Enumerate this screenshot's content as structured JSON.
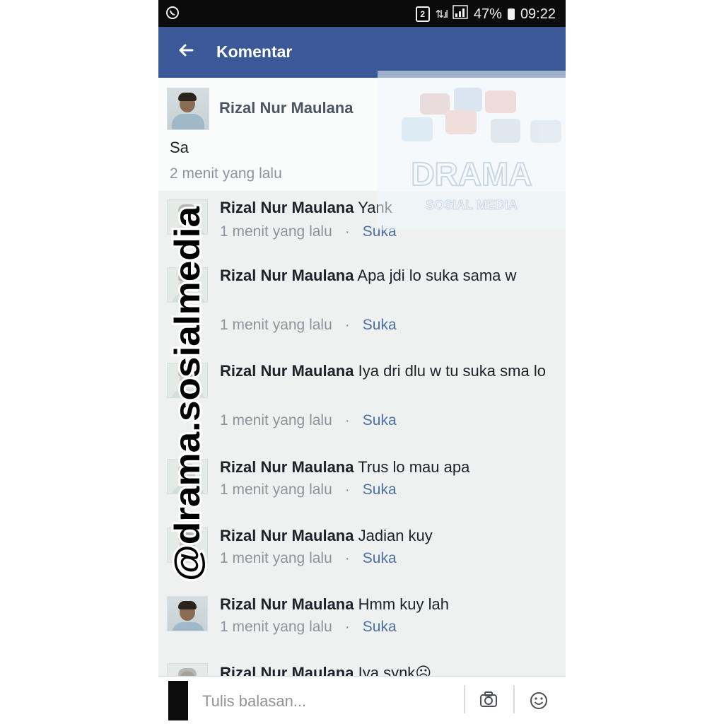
{
  "status_bar": {
    "left_icon": "whatsapp-icon",
    "sim": "2",
    "battery": "47%",
    "time": "09:22"
  },
  "header": {
    "back_icon": "arrow-left-icon",
    "title": "Komentar"
  },
  "main_comment": {
    "author": "Rizal Nur Maulana",
    "text": "Sa",
    "time": "2 menit yang lalu"
  },
  "replies": [
    {
      "author": "Rizal Nur Maulana",
      "text": "Yank",
      "time": "1 menit yang lalu",
      "sep": "·",
      "like": "Suka"
    },
    {
      "author": "Rizal Nur Maulana",
      "text": "Apa jdi lo suka sama w",
      "time": "1 menit yang lalu",
      "sep": "·",
      "like": "Suka"
    },
    {
      "author": "Rizal Nur Maulana",
      "text": "Iya dri dlu w tu suka sma lo",
      "time": "1 menit yang lalu",
      "sep": "·",
      "like": "Suka"
    },
    {
      "author": "Rizal Nur Maulana",
      "text": "Trus lo mau apa",
      "time": "1 menit yang lalu",
      "sep": "·",
      "like": "Suka"
    },
    {
      "author": "Rizal Nur Maulana",
      "text": "Jadian kuy",
      "time": "1 menit yang lalu",
      "sep": "·",
      "like": "Suka"
    },
    {
      "author": "Rizal Nur Maulana",
      "text": "Hmm kuy lah",
      "time": "1 menit yang lalu",
      "sep": "·",
      "like": "Suka"
    },
    {
      "author": "Rizal Nur Maulana",
      "text": "Iya synk☹"
    }
  ],
  "watermark": {
    "handle": "@drama.sosialmedia",
    "logo_title": "DRAMA",
    "logo_subtitle": "SOSIAL MEDIA"
  },
  "reply_bar": {
    "placeholder": "Tulis balasan...",
    "camera_icon": "camera-icon",
    "emoji_icon": "smile-icon"
  },
  "colors": {
    "app_bar": "#3b5998",
    "status_bar": "#0b0b0b",
    "like_link": "#4a6fa5",
    "meta_text": "#8e949b"
  }
}
